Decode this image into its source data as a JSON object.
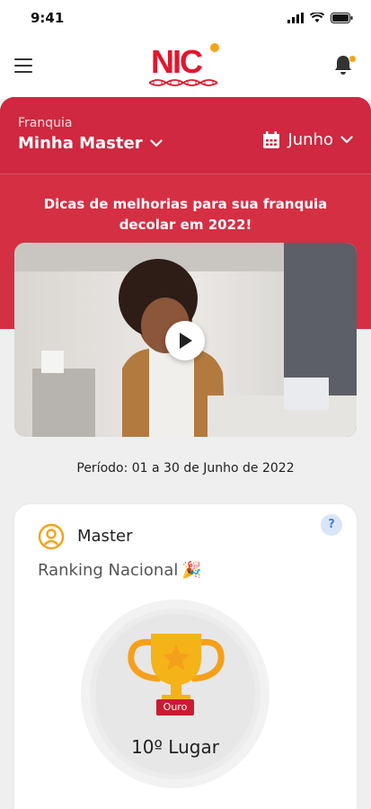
{
  "status_bar": {
    "time": "9:41"
  },
  "app": {
    "logo_text": "NIC"
  },
  "hero": {
    "franchise_label": "Franquia",
    "franchise_value": "Minha Master",
    "month_value": "Junho",
    "tips_text": "Dicas de melhorias para sua franquia decolar em 2022!"
  },
  "period": {
    "text": "Período: 01 a 30 de Junho de 2022"
  },
  "ranking_card": {
    "title": "Master",
    "help_symbol": "?",
    "subtitle": "Ranking Nacional",
    "emoji": "🎉",
    "badge": "Ouro",
    "place": "10º Lugar"
  },
  "colors": {
    "brand_red": "#d52f43",
    "accent_orange": "#f6a21a",
    "trophy_gold": "#f5b31a"
  }
}
